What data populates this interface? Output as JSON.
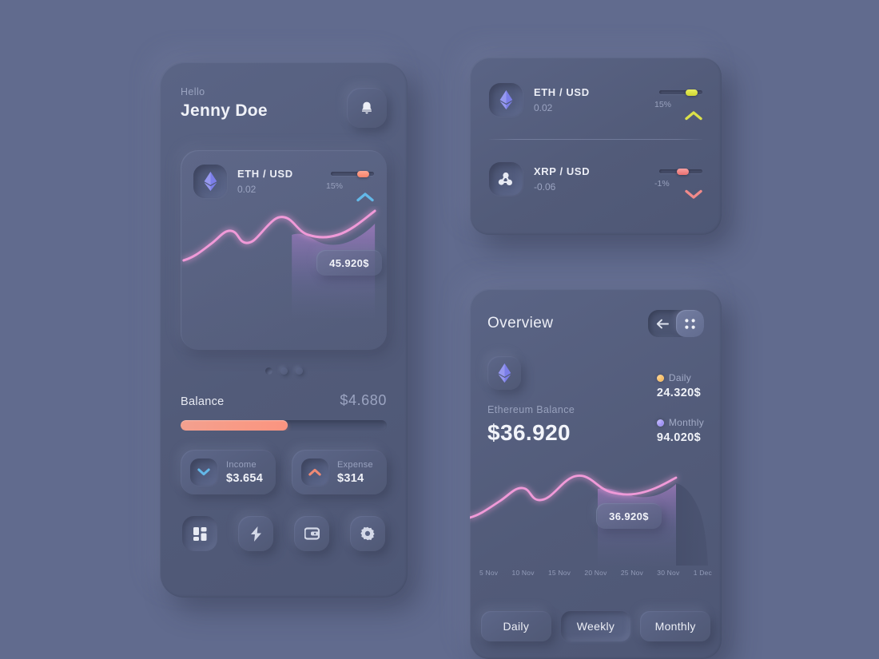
{
  "theme": {
    "background": "#616b8e",
    "card": "#535c7b",
    "text_primary": "#f0f2f8",
    "text_muted": "#99a2bf",
    "accent_pink": "#f09ad8",
    "accent_coral": "#fb9480",
    "accent_blue": "#63b8e8",
    "accent_yellow": "#dbe14a",
    "accent_red": "#f08a8a",
    "accent_purple": "#7b7ee8",
    "accent_orange": "#f0a83c"
  },
  "phone_left": {
    "greeting": "Hello",
    "user_name": "Jenny Doe",
    "bell_icon": "bell-icon",
    "ticker": {
      "coin_icon": "ethereum-icon",
      "pair": "ETH / USD",
      "value": "0.02",
      "percent": "15%",
      "trend": "up",
      "slider_thumb_color": "#fb9480",
      "slider_position": 62
    },
    "chart": {
      "tooltip": "45.920$"
    },
    "pagination": {
      "dots": 3,
      "active_index": 0
    },
    "balance": {
      "label": "Balance",
      "amount": "$4.680",
      "progress_percent": 52,
      "progress_color": "#fb9480"
    },
    "income": {
      "label": "Income",
      "amount": "$3.654",
      "icon": "chevron-down-icon",
      "icon_color": "#63b8e8"
    },
    "expense": {
      "label": "Expense",
      "amount": "$314",
      "icon": "chevron-up-icon",
      "icon_color": "#f08a75"
    },
    "nav": [
      {
        "name": "dashboard",
        "icon": "grid-icon",
        "active": true
      },
      {
        "name": "activity",
        "icon": "lightning-icon",
        "active": false
      },
      {
        "name": "wallet",
        "icon": "wallet-icon",
        "active": false
      },
      {
        "name": "settings",
        "icon": "gear-icon",
        "active": false
      }
    ]
  },
  "market_card": {
    "rows": [
      {
        "coin_icon": "ethereum-icon",
        "pair": "ETH / USD",
        "value": "0.02",
        "percent": "15%",
        "trend": "up",
        "thumb_color": "#dbe14a",
        "chevron_color": "#dbe14a",
        "slider_position": 62
      },
      {
        "coin_icon": "ripple-icon",
        "pair": "XRP / USD",
        "value": "-0.06",
        "percent": "-1%",
        "trend": "down",
        "thumb_color": "#f08a8a",
        "chevron_color": "#f08a8a",
        "slider_position": 40
      }
    ]
  },
  "overview_card": {
    "title": "Overview",
    "back_icon": "arrow-left-icon",
    "grid_icon": "grid-dots-icon",
    "coin_icon": "ethereum-icon",
    "balance_label": "Ethereum Balance",
    "balance_amount": "$36.920",
    "stats": [
      {
        "label": "Daily",
        "value": "24.320$",
        "dot_color": "#f0a83c"
      },
      {
        "label": "Monthly",
        "value": "94.020$",
        "dot_color": "#8a7cf0"
      }
    ],
    "chart_tooltip": "36.920$",
    "tabs": [
      {
        "label": "Daily",
        "selected": false
      },
      {
        "label": "Weekly",
        "selected": true
      },
      {
        "label": "Monthly",
        "selected": false
      }
    ]
  },
  "chart_data": [
    {
      "id": "phone_left_chart",
      "type": "area",
      "title": "ETH / USD price",
      "xlabel": "",
      "ylabel": "",
      "line_color": "#f09ad8",
      "grid": true,
      "legend": "none",
      "annotations": [
        "45.920$"
      ],
      "x": [
        0,
        1,
        2,
        3,
        4,
        5,
        6,
        7,
        8,
        9,
        10,
        11,
        12
      ],
      "values": [
        18,
        24,
        36,
        52,
        48,
        44,
        56,
        70,
        74,
        66,
        62,
        64,
        78
      ],
      "ylim": [
        0,
        100
      ]
    },
    {
      "id": "overview_chart",
      "type": "area",
      "title": "Ethereum Balance trend",
      "xlabel": "",
      "ylabel": "",
      "line_color": "#f09ad8",
      "grid": true,
      "legend": "none",
      "annotations": [
        "36.920$"
      ],
      "categories": [
        "5 Nov",
        "10 Nov",
        "15 Nov",
        "20 Nov",
        "25 Nov",
        "30 Nov",
        "1 Dec"
      ],
      "x": [
        0,
        1,
        2,
        3,
        4,
        5,
        6,
        7,
        8,
        9,
        10,
        11,
        12
      ],
      "values": [
        18,
        26,
        38,
        54,
        48,
        44,
        58,
        72,
        74,
        66,
        62,
        64,
        80
      ],
      "ylim": [
        0,
        100
      ]
    }
  ]
}
